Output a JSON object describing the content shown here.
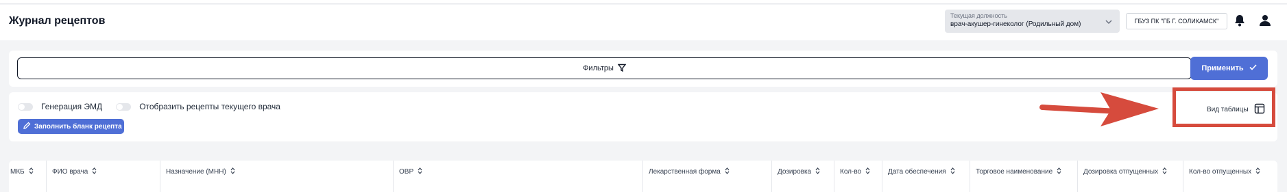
{
  "header": {
    "title": "Журнал рецептов",
    "position_label": "Текущая должность",
    "position_value": "врач-акушер-гинеколог (Родильный дом)",
    "organization": "ГБУЗ ПК \"ГБ Г. СОЛИКАМСК\""
  },
  "filters": {
    "filters_label": "Фильтры",
    "apply_label": "Применить"
  },
  "tools": {
    "toggle_emd_label": "Генерация ЭМД",
    "toggle_current_doctor_label": "Отобразить рецепты текущего врача",
    "fill_form_label": "Заполнить бланк рецепта",
    "table_view_label": "Вид таблицы"
  },
  "table": {
    "columns": [
      "МКБ",
      "ФИО врача",
      "Назначение (МНН)",
      "ОВР",
      "Лекарственная форма",
      "Дозировка",
      "Кол-во",
      "Дата обеспечения",
      "Торговое наименование",
      "Дозировка отпущенных",
      "Кол-во отпущенных"
    ]
  },
  "colors": {
    "accent": "#4f6fd6",
    "annotation": "#d64b3d",
    "background": "#f3f4f6"
  }
}
